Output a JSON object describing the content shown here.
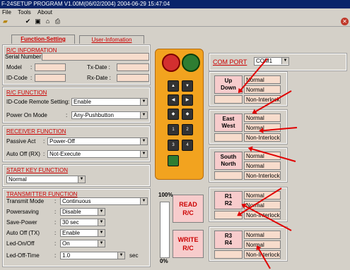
{
  "window": {
    "title": "F-24SETUP PROGRAM V1.00M(06/02/2004)  2004-06-29  15:47:04"
  },
  "menu": [
    "File",
    "Tools",
    "About"
  ],
  "toolbar_icons": [
    "open-folder-icon",
    "checkmark-icon",
    "save-disk-icon",
    "home-icon",
    "printer-icon"
  ],
  "tabs": {
    "function": "Function-Setting",
    "user": "User-Infomation"
  },
  "rc_info": {
    "heading": "R/C INFORMATION",
    "serial_label": "Serial Number:",
    "model_label": "Model",
    "idcode_label": "ID-Code",
    "txdate_label": "Tx-Date :",
    "rxdate_label": "Rx-Date :",
    "colon": ":"
  },
  "rc_function": {
    "heading": "R/C  FUNCTION",
    "idcode_remote_label": "ID-Code Remote Setting:",
    "idcode_remote_value": "Enable",
    "power_on_label": "Power On Mode",
    "power_on_value": "Any-Pushbutton",
    "colon": ":"
  },
  "receiver_function": {
    "heading": "RECEIVER  FUNCTION",
    "passive_label": "Passive Act",
    "passive_value": "Power-Off",
    "autooff_label": "Auto Off (RX)",
    "autooff_value": "Not-Execute",
    "colon": ":"
  },
  "start_key": {
    "heading": "START KEY FUNCTION",
    "value": "Normal"
  },
  "transmitter_function": {
    "heading": "TRANSMITTER FUNCTION",
    "rows": [
      {
        "label": "Transmit Mode",
        "value": "Continuous"
      },
      {
        "label": "Powersaving",
        "value": "Disable"
      },
      {
        "label": "Save-Power",
        "value": "30 sec"
      },
      {
        "label": "Auto Off (TX)",
        "value": "Enable"
      },
      {
        "label": "Led-On/Off",
        "value": "On"
      },
      {
        "label": "Led-Off-Time",
        "value": "1.0"
      }
    ],
    "sec_label": "sec",
    "colon": ":"
  },
  "progress": {
    "top_label": "100%",
    "bottom_label": "0%",
    "fraction": 0.0
  },
  "actions": {
    "read": "READ\nR/C",
    "write": "WRITE\nR/C"
  },
  "com_port": {
    "label": "COM  PORT",
    "value": "COM1"
  },
  "groups": [
    {
      "line1": "Up",
      "line2": "Down",
      "opts": [
        "Normal",
        "Normal",
        "Non-Interlock"
      ]
    },
    {
      "line1": "East",
      "line2": "West",
      "opts": [
        "Normal",
        "Normal",
        "Non-Interlock"
      ]
    },
    {
      "line1": "South",
      "line2": "North",
      "opts": [
        "Normal",
        "Normal",
        "Non-Interlock"
      ]
    },
    {
      "line1": "R1",
      "line2": "R2",
      "opts": [
        "Normal",
        "Normal",
        "Non-Interlock"
      ]
    },
    {
      "line1": "R3",
      "line2": "R4",
      "opts": [
        "Normal",
        "Normal",
        "Non-Interlock"
      ]
    }
  ],
  "remote_buttons": [
    "1",
    "2",
    "3",
    "4"
  ],
  "colors": {
    "accent_red": "#cc0000",
    "field_pink": "#f7dccc",
    "title_blue": "#0a246a",
    "annotation_red": "#e00000"
  }
}
